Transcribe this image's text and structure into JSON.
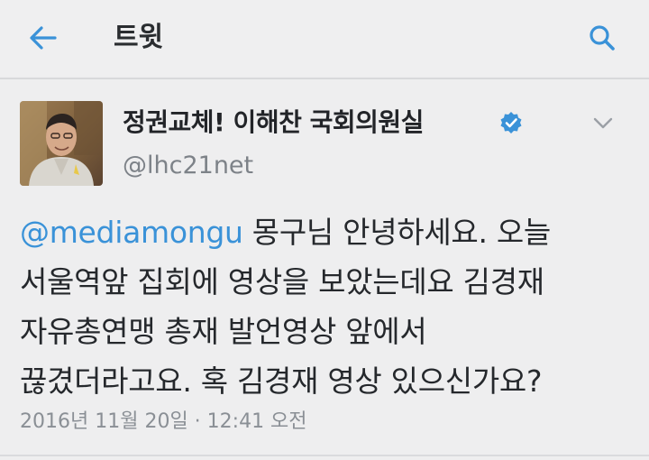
{
  "header": {
    "title": "트윗",
    "back_icon": "back-arrow-icon",
    "search_icon": "search-icon",
    "accent_color": "#3a92d8"
  },
  "tweet": {
    "author": {
      "name": "정권교체! 이해찬 국회의원실",
      "verified_icon": "verified-badge-icon",
      "handle": "@lhc21net"
    },
    "more_icon": "chevron-down-icon",
    "body": {
      "mention": "@mediamongu",
      "line1_rest": " 몽구님 안녕하세요. 오늘",
      "line2": "서울역앞 집회에 영상을 보았는데요 김경재",
      "line3": "자유총연맹 총재 발언영상 앞에서",
      "line4": "끊겼더라고요. 혹 김경재 영상 있으신가요?"
    },
    "timestamp": "2016년 11월 20일 · 12:41 오전"
  }
}
